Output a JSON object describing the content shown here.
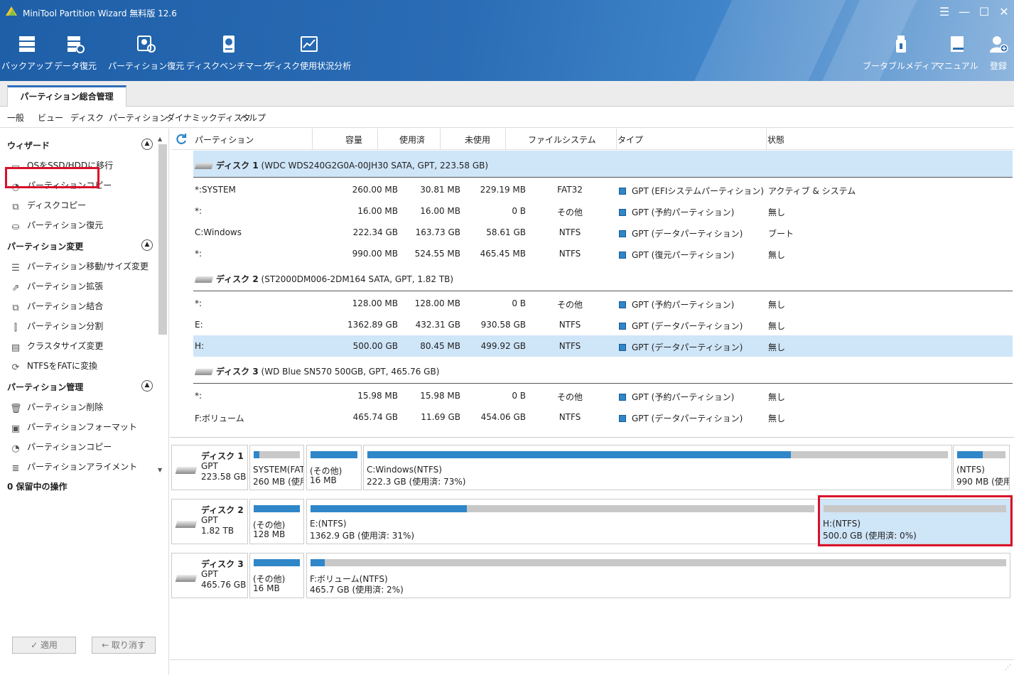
{
  "app": {
    "title": "MiniTool Partition Wizard 無料版 12.6"
  },
  "window_controls": {
    "menu": "☰",
    "minimize": "—",
    "maximize": "☐",
    "close": "✕"
  },
  "toolbar": {
    "left": [
      {
        "label": "バックアップ",
        "icon": "backup-icon"
      },
      {
        "label": "データ復元",
        "icon": "data-recovery-icon"
      },
      {
        "label": "パーティション復元",
        "icon": "partition-recovery-icon"
      },
      {
        "label": "ディスクベンチマーク",
        "icon": "disk-benchmark-icon"
      },
      {
        "label": "ディスク使用状況分析",
        "icon": "space-analyzer-icon"
      }
    ],
    "right": [
      {
        "label": "ブータブルメディア",
        "icon": "bootable-media-icon"
      },
      {
        "label": "マニュアル",
        "icon": "manual-icon"
      },
      {
        "label": "登録",
        "icon": "register-icon"
      }
    ]
  },
  "tab": {
    "label": "パーティション総合管理"
  },
  "menu": [
    "一般",
    "ビュー",
    "ディスク",
    "パーティション",
    "ダイナミックディスク",
    "ヘルプ"
  ],
  "sidebar": {
    "groups": [
      {
        "title": "ウィザード",
        "items": [
          "OSをSSD/HDDに移行",
          "パーティションコピー",
          "ディスクコピー",
          "パーティション復元"
        ]
      },
      {
        "title": "パーティション変更",
        "items": [
          "パーティション移動/サイズ変更",
          "パーティション拡張",
          "パーティション結合",
          "パーティション分割",
          "クラスタサイズ変更",
          "NTFSをFATに変換"
        ]
      },
      {
        "title": "パーティション管理",
        "items": [
          "パーティション削除",
          "パーティションフォーマット",
          "パーティションコピー",
          "パーティションアライメント"
        ]
      }
    ],
    "pending": "0 保留中の操作",
    "apply": "✓ 適用",
    "undo": "← 取り消す"
  },
  "grid": {
    "columns": [
      "パーティション",
      "容量",
      "使用済",
      "未使用",
      "ファイルシステム",
      "タイプ",
      "状態"
    ],
    "disks": [
      {
        "label": "ディスク 1",
        "info": "(WDC WDS240G2G0A-00JH30 SATA, GPT, 223.58 GB)",
        "rows": [
          [
            "*:SYSTEM",
            "260.00 MB",
            "30.81 MB",
            "229.19 MB",
            "FAT32",
            "GPT (EFIシステムパーティション)",
            "アクティブ & システム"
          ],
          [
            "*:",
            "16.00 MB",
            "16.00 MB",
            "0 B",
            "その他",
            "GPT (予約パーティション)",
            "無し"
          ],
          [
            "C:Windows",
            "222.34 GB",
            "163.73 GB",
            "58.61 GB",
            "NTFS",
            "GPT (データパーティション)",
            "ブート"
          ],
          [
            "*:",
            "990.00 MB",
            "524.55 MB",
            "465.45 MB",
            "NTFS",
            "GPT (復元パーティション)",
            "無し"
          ]
        ]
      },
      {
        "label": "ディスク 2",
        "info": "(ST2000DM006-2DM164 SATA, GPT, 1.82 TB)",
        "rows": [
          [
            "*:",
            "128.00 MB",
            "128.00 MB",
            "0 B",
            "その他",
            "GPT (予約パーティション)",
            "無し"
          ],
          [
            "E:",
            "1362.89 GB",
            "432.31 GB",
            "930.58 GB",
            "NTFS",
            "GPT (データパーティション)",
            "無し"
          ],
          [
            "H:",
            "500.00 GB",
            "80.45 MB",
            "499.92 GB",
            "NTFS",
            "GPT (データパーティション)",
            "無し"
          ]
        ]
      },
      {
        "label": "ディスク 3",
        "info": "(WD Blue SN570 500GB, GPT, 465.76 GB)",
        "rows": [
          [
            "*:",
            "15.98 MB",
            "15.98 MB",
            "0 B",
            "その他",
            "GPT (予約パーティション)",
            "無し"
          ],
          [
            "F:ボリューム",
            "465.74 GB",
            "11.69 GB",
            "454.06 GB",
            "NTFS",
            "GPT (データパーティション)",
            "無し"
          ]
        ]
      }
    ]
  },
  "map": {
    "disks": [
      {
        "name": "ディスク 1",
        "type": "GPT",
        "size": "223.58 GB",
        "parts": [
          {
            "l1": "SYSTEM(FAT3",
            "l2": "260 MB (使用",
            "used": 0.12
          },
          {
            "l1": "(その他)",
            "l2": "16 MB",
            "used": 1.0
          },
          {
            "l1": "C:Windows(NTFS)",
            "l2": "222.3 GB (使用済: 73%)",
            "used": 0.73
          },
          {
            "l1": "(NTFS)",
            "l2": "990 MB (使用",
            "used": 0.53
          }
        ]
      },
      {
        "name": "ディスク 2",
        "type": "GPT",
        "size": "1.82 TB",
        "parts": [
          {
            "l1": "(その他)",
            "l2": "128 MB",
            "used": 1.0
          },
          {
            "l1": "E:(NTFS)",
            "l2": "1362.9 GB (使用済: 31%)",
            "used": 0.31
          },
          {
            "l1": "H:(NTFS)",
            "l2": "500.0 GB (使用済: 0%)",
            "used": 0.0
          }
        ]
      },
      {
        "name": "ディスク 3",
        "type": "GPT",
        "size": "465.76 GB",
        "parts": [
          {
            "l1": "(その他)",
            "l2": "16 MB",
            "used": 1.0
          },
          {
            "l1": "F:ボリューム(NTFS)",
            "l2": "465.7 GB (使用済: 2%)",
            "used": 0.02
          }
        ]
      }
    ]
  },
  "colors": {
    "accent": "#2f86c8",
    "selected": "#cfe5f8",
    "highlight": "#d8102a",
    "titlebar": "#2a6cb5"
  }
}
